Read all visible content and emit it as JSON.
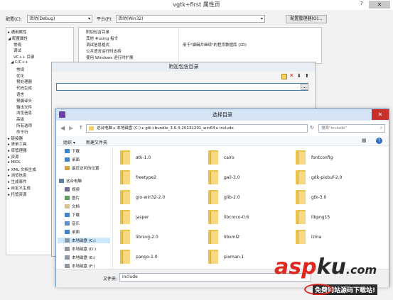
{
  "main_window": {
    "title": "vgtk+first 属性页",
    "config_label": "配置(C):",
    "config_value": "活动(Debug)",
    "platform_label": "平台(P):",
    "platform_value": "活动(Win32)",
    "config_manager": "配置管理器(O)...",
    "tree": [
      "▸ 通用属性",
      "◢ 配置属性",
      "常规",
      "调试",
      "VC++ 目录",
      "◢ C/C++",
      "常规",
      "优化",
      "预处理器",
      "代码生成",
      "语言",
      "预编译头",
      "输出文件",
      "浏览信息",
      "高级",
      "所有选项",
      "命令行",
      "▸ 链接器",
      "▸ 清单工具",
      "▸ 库管理器",
      "▸ 资源",
      "▸ MIDL",
      "▸ XML 文档生成",
      "▸ 浏览信息",
      "▸ 生成事件",
      "▸ 自定义生成",
      "▸ 托管资源"
    ],
    "props": [
      {
        "name": "附加包含目录",
        "value": ""
      },
      {
        "name": "其他 #using 指令",
        "value": ""
      },
      {
        "name": "调试信息格式",
        "value": "用于\"编辑并继续\"的程序数据库 (/ZI)"
      },
      {
        "name": "公共语言运行时支持",
        "value": ""
      },
      {
        "name": "使用 Windows 运行时扩展",
        "value": ""
      }
    ]
  },
  "include_dialog": {
    "title": "附加包含目录",
    "toolbar": [
      "new-line",
      "delete",
      "move-down",
      "move-up"
    ],
    "browse_label": "..."
  },
  "picker": {
    "title": "选择目录",
    "breadcrumb": [
      "这台电脑",
      "本地磁盘 (C:)",
      "gtk+bundle_3.6.4-20131201_win64",
      "include"
    ],
    "search_placeholder": "搜索\"include\"",
    "organize": "组织 ▾",
    "new_folder": "新建文件夹",
    "nav": [
      {
        "label": "下载",
        "icon": "download-icon"
      },
      {
        "label": "桌面",
        "icon": "desktop-icon"
      },
      {
        "label": "最近访问的位置",
        "icon": "recent-icon"
      },
      {
        "label": "这台电脑",
        "icon": "computer-icon"
      },
      {
        "label": "视频",
        "icon": "video-icon"
      },
      {
        "label": "图片",
        "icon": "pictures-icon"
      },
      {
        "label": "文档",
        "icon": "documents-icon"
      },
      {
        "label": "下载",
        "icon": "download-icon"
      },
      {
        "label": "音乐",
        "icon": "music-icon"
      },
      {
        "label": "桌面",
        "icon": "desktop-icon"
      },
      {
        "label": "本地磁盘 (C:)",
        "icon": "drive-icon"
      },
      {
        "label": "本地磁盘 (D:)",
        "icon": "drive-icon"
      },
      {
        "label": "本地磁盘 (E:)",
        "icon": "drive-icon"
      },
      {
        "label": "本地磁盘 (F:)",
        "icon": "drive-icon"
      }
    ],
    "folders": [
      "atk-1.0",
      "cairo",
      "fontconfig",
      "freetype2",
      "gail-3.0",
      "gdk-pixbuf-2.0",
      "gio-win32-2.0",
      "glib-2.0",
      "gtk-3.0",
      "jasper",
      "libcroco-0.6",
      "libpng15",
      "librsvg-2.0",
      "libxml2",
      "lzma",
      "pango-1.0",
      "pixman-1",
      ""
    ],
    "filename_label": "文件夹:",
    "filename_value": "include"
  },
  "watermark": {
    "brand_main": "asp",
    "brand_accent": "ku",
    "brand_tail": ".com",
    "tagline": "免费网站源码下载站!"
  },
  "colors": {
    "accent_red": "#e0281e",
    "folder_yellow": "#f6d982",
    "title_blue": "#d7e6f5"
  }
}
